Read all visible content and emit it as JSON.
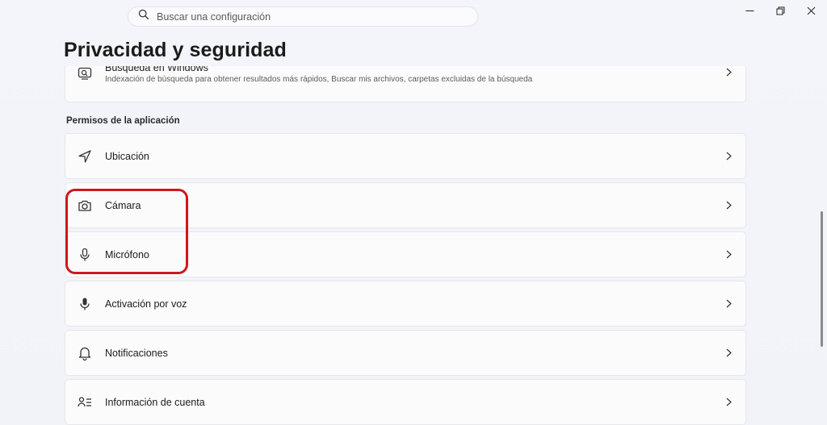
{
  "search": {
    "placeholder": "Buscar una configuración"
  },
  "page": {
    "title": "Privacidad y seguridad"
  },
  "search_card": {
    "title": "Búsqueda en Windows",
    "description": "Indexación de búsqueda para obtener resultados más rápidos, Buscar mis archivos, carpetas excluidas de la búsqueda",
    "icon": "search-windows-icon"
  },
  "section": {
    "label": "Permisos de la aplicación"
  },
  "items": [
    {
      "label": "Ubicación",
      "icon": "location-icon"
    },
    {
      "label": "Cámara",
      "icon": "camera-icon"
    },
    {
      "label": "Micrófono",
      "icon": "microphone-icon"
    },
    {
      "label": "Activación por voz",
      "icon": "voice-activation-icon"
    },
    {
      "label": "Notificaciones",
      "icon": "bell-icon"
    },
    {
      "label": "Información de cuenta",
      "icon": "account-info-icon"
    }
  ],
  "colors": {
    "highlight": "#d0161e",
    "background": "#f3f4f9",
    "card": "#fbfbfc"
  }
}
